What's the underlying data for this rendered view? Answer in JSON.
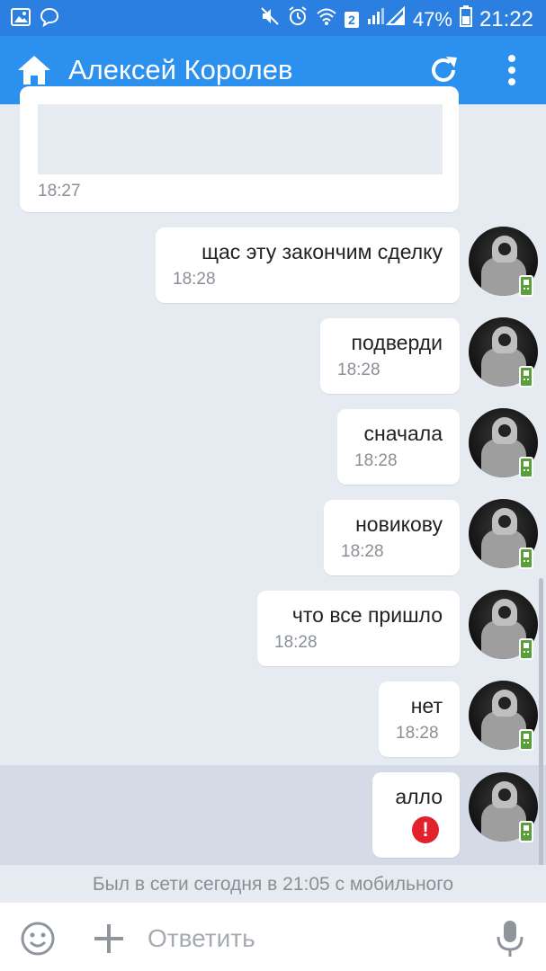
{
  "status_bar": {
    "notification_icons": [
      "image-icon",
      "chat-icon"
    ],
    "system_icons": [
      "mute-icon",
      "alarm-icon",
      "wifi-icon",
      "signal-icon"
    ],
    "sim_badge": "2",
    "battery": "47%",
    "time": "21:22"
  },
  "header": {
    "title": "Алексей Королев",
    "icons": [
      "home-icon",
      "refresh-icon",
      "more-vert-icon"
    ]
  },
  "colors": {
    "status_bar": "#2a7fe0",
    "app_bar": "#2b90ee",
    "chat_background": "#e6ebf2",
    "error": "#e2212a",
    "online_mobile": "#5aa03a"
  },
  "previous_message": {
    "time": "18:27"
  },
  "messages": [
    {
      "text": "щас эту закончим сделку",
      "time": "18:28"
    },
    {
      "text": "подверди",
      "time": "18:28"
    },
    {
      "text": "сначала",
      "time": "18:28"
    },
    {
      "text": "новикову",
      "time": "18:28"
    },
    {
      "text": "что все пришло",
      "time": "18:28"
    },
    {
      "text": "нет",
      "time": "18:28"
    },
    {
      "text": "алло",
      "status": "failed",
      "status_icon": "error-icon"
    }
  ],
  "last_seen": "Был в сети сегодня в 21:05 с мобильного",
  "composer": {
    "placeholder": "Ответить",
    "value": "",
    "icons": [
      "emoji-icon",
      "plus-icon",
      "mic-icon"
    ]
  }
}
